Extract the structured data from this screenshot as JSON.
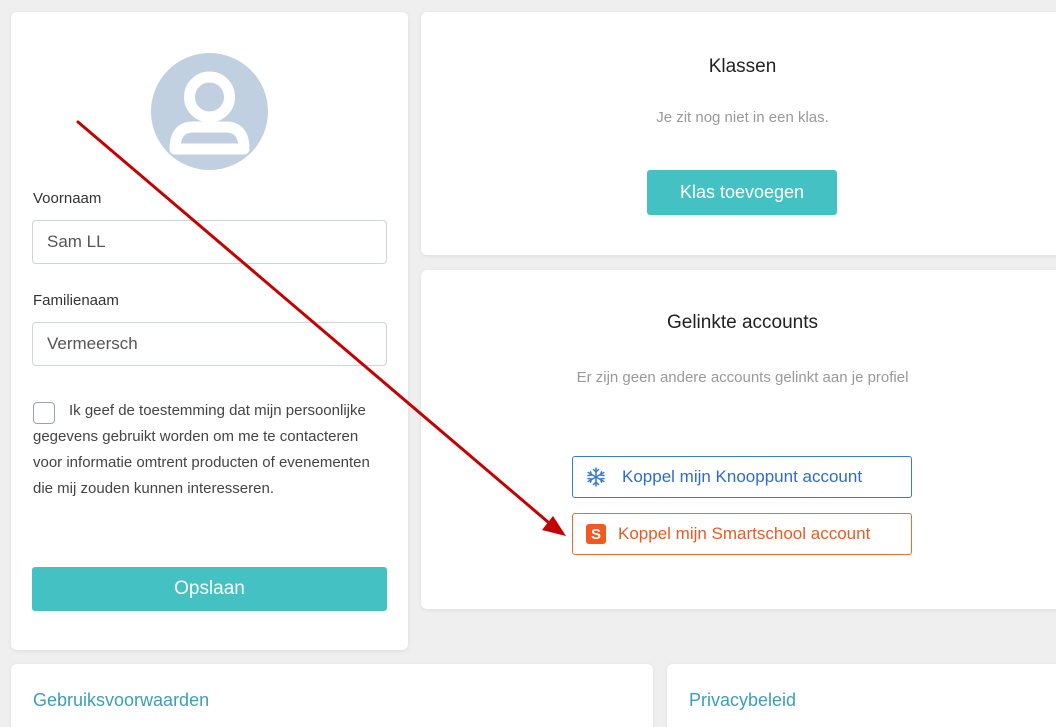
{
  "profile": {
    "first_name_label": "Voornaam",
    "first_name_value": "Sam LL",
    "last_name_label": "Familienaam",
    "last_name_value": "Vermeersch",
    "consent_text": "Ik geef de toestemming dat mijn persoonlijke gegevens gebruikt worden om me te contacteren voor informatie omtrent producten of evenementen die mij zouden kunnen interesseren.",
    "consent_checked": false,
    "save_label": "Opslaan"
  },
  "classes": {
    "title": "Klassen",
    "empty_text": "Je zit nog niet in een klas.",
    "add_label": "Klas toevoegen"
  },
  "linked_accounts": {
    "title": "Gelinkte accounts",
    "empty_text": "Er zijn geen andere accounts gelinkt aan je profiel",
    "knooppunt_label": "Koppel mijn Knooppunt account",
    "smartschool_label": "Koppel mijn Smartschool account",
    "smartschool_icon_letter": "S"
  },
  "footer": {
    "terms_label": "Gebruiksvoorwaarden",
    "privacy_label": "Privacybeleid"
  },
  "icons": {
    "avatar": "user-avatar-icon",
    "knooppunt": "knooppunt-snowflake-icon",
    "smartschool": "smartschool-logo-icon",
    "annotation": "red-arrow-annotation"
  },
  "colors": {
    "accent_teal": "#44c2c3",
    "knooppunt_blue": "#3a7ad6",
    "smartschool_orange": "#ef6a35",
    "link_teal": "#3a9fb8",
    "annotation_red": "#c40000"
  }
}
